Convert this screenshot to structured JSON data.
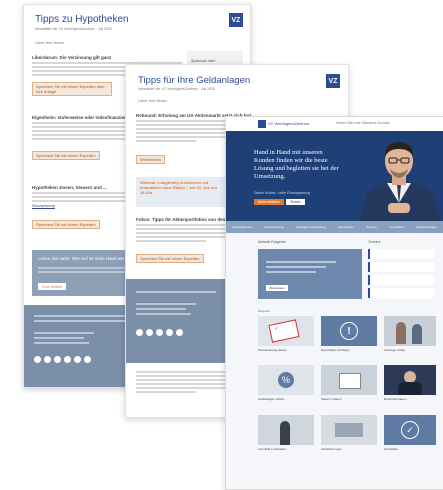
{
  "colors": {
    "brand": "#2e4a92",
    "accent_orange": "#e07a35",
    "footer": "#7b8fa8",
    "hero": "#1f3f77"
  },
  "doc1": {
    "title": "Tipps zu Hypotheken",
    "subtitle": "Newsletter der VZ VermögensZentrum · Juli 2020",
    "date_line": "Lieber Herr Muster",
    "logo": "VZ",
    "s1_heading": "Liberdarum: Die Verzinsung gilt ganz",
    "s1_side": "Sparkonto nicht",
    "s1_button": "Sprechen Sie mit einem Experten über Ihre Anlage",
    "s2_heading": "Eigenheim: stufenweise oder Indexfinanzierung?",
    "s2_button": "Sprechen Sie mit einem Experten",
    "s3_heading": "Hypotheken zinsen, Steuern und ...",
    "s3_link": "Steuerplanung",
    "s3_button": "Sprechen Sie mit einem Experten",
    "s4_heading": "Lesen Sie mehr: Wie viel ist mein Haus wert?",
    "s4_button": "Zum Artikel"
  },
  "doc2": {
    "title": "Tipps für Ihre Geldanlagen",
    "subtitle": "Newsletter der VZ VermögensZentrum · Juli 2020",
    "date_line": "Lieber Herr Muster",
    "logo": "VZ",
    "s1_heading": "Rebound: Erholung am US-Aktienmarkt setzt sich fort",
    "s1_button": "Weiterlesen",
    "callout": "Webinar: Langfristig investieren mit Immobilien ohne Risiko – am 23. Juli um 18 Uhr",
    "s2_heading": "Fokus: Tipps für Aktienportfolios von den Experten",
    "s2_button": "Sprechen Sie mit einem Experten"
  },
  "web": {
    "logo": "VZ VermögensZentrum",
    "nav": [
      "Home",
      "Über uns",
      "Standorte",
      "Kontakt"
    ],
    "hero_quote": "Hand in Hand mit unseren Kunden finden wir die beste Lösung und begleiten sie bei der Umsetzung.",
    "hero_author": "Daniel Muster, Leiter Finanzplanung",
    "hero_btn1": "Mehr erfahren",
    "hero_btn2": "Termin",
    "menu": [
      "Finanzplanung",
      "Pensionierung",
      "Vermögensverwaltung",
      "Hypotheken",
      "Steuern",
      "Immobilien",
      "Versicherungen"
    ],
    "section_news": "Aktuelle Ratgeber",
    "section_side": "Termine",
    "feature_btn": "Weiterlesen",
    "cards_row1": [
      "Pensionierung planen",
      "Hypotheken kündigen",
      "Vorsorge richtig"
    ],
    "cards_row2": [
      "Geldanlagen prüfen",
      "Steuern sparen",
      "Erbschaft planen"
    ],
    "cards_row3": [
      "Immobilien verkaufen",
      "Versicherungen",
      "Checkliste"
    ],
    "card_label": "Ratgeber"
  }
}
